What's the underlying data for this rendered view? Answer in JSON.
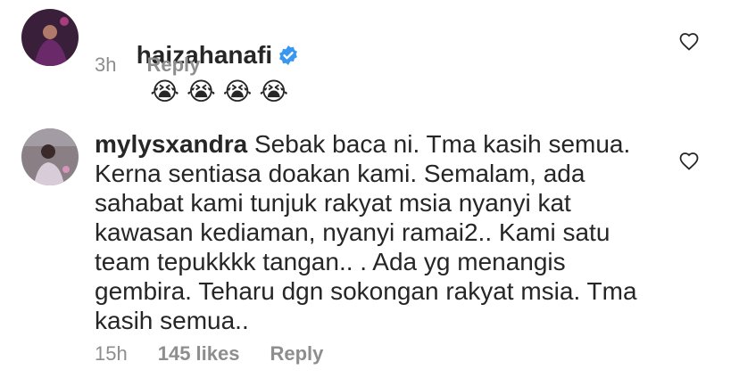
{
  "comments": [
    {
      "username": "haizahanafi",
      "verified": true,
      "text": "",
      "emoji": [
        "😭",
        "😭",
        "😭",
        "😭"
      ],
      "time": "3h",
      "likes": "",
      "reply": "Reply"
    },
    {
      "username": "mylysxandra",
      "verified": false,
      "text": "Sebak baca ni. Tma kasih semua. Kerna sentiasa doakan kami. Semalam, ada sahabat kami tunjuk rakyat msia nyanyi kat kawasan kediaman, nyanyi ramai2.. Kami satu team tepukkkk tangan.. . Ada yg menangis gembira. Teharu dgn sokongan rakyat msia. Tma kasih semua..",
      "time": "15h",
      "likes": "145 likes",
      "reply": "Reply"
    }
  ],
  "colors": {
    "text": "#262626",
    "meta": "#8e8e8e",
    "verified": "#3897f0"
  },
  "icons": {
    "like": "heart-outline-icon",
    "verified": "verified-badge-icon",
    "emoji": "loudly-crying-face-emoji"
  }
}
